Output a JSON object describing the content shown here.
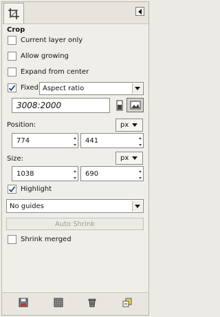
{
  "panel": {
    "title": "Crop"
  },
  "options": {
    "current_layer_only": {
      "label": "Current layer only",
      "checked": false
    },
    "allow_growing": {
      "label": "Allow growing",
      "checked": false
    },
    "expand_from_center": {
      "label": "Expand from center",
      "checked": false
    },
    "fixed": {
      "label": "Fixed:",
      "checked": true,
      "mode": "Aspect ratio",
      "value": "3008:2000"
    },
    "position": {
      "label": "Position:",
      "unit": "px",
      "x": "774",
      "y": "441"
    },
    "size": {
      "label": "Size:",
      "unit": "px",
      "w": "1038",
      "h": "690"
    },
    "highlight": {
      "label": "Highlight",
      "checked": true
    },
    "guides": "No guides",
    "auto_shrink": "Auto Shrink",
    "shrink_merged": {
      "label": "Shrink merged",
      "checked": false
    }
  },
  "icons": {
    "tool_tab": "crop-tool-icon",
    "tab_menu": "tab-menu-icon",
    "portrait": "portrait-icon",
    "landscape": "landscape-icon",
    "save": "save-preset-icon",
    "restore": "restore-preset-icon",
    "delete": "delete-icon",
    "reset": "reset-icon"
  },
  "colors": {
    "accent": "#5a89b8",
    "checkmark": "#1d3f7a"
  }
}
